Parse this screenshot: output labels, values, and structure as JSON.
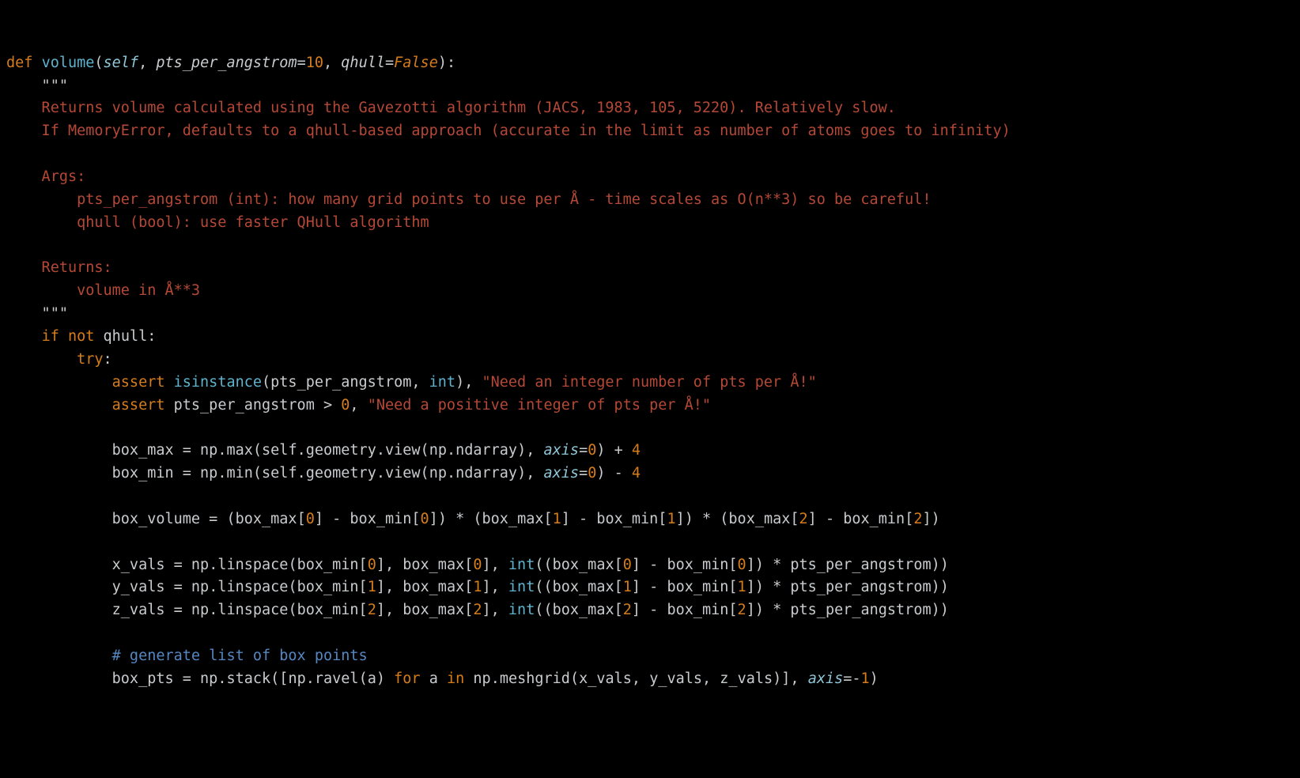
{
  "code": {
    "l01": {
      "def": "def",
      "sp": " ",
      "name": "volume",
      "lp": "(",
      "self": "self",
      "c1": ", ",
      "p1": "pts_per_angstrom",
      "eq1": "=",
      "v1": "10",
      "c2": ", ",
      "p2": "qhull",
      "eq2": "=",
      "v2": "False",
      "rp": "):"
    },
    "l02": "    \"\"\"",
    "l03": "    Returns volume calculated using the Gavezotti algorithm (JACS, 1983, 105, 5220). Relatively slow.",
    "l04": "    If MemoryError, defaults to a qhull-based approach (accurate in the limit as number of atoms goes to infinity)",
    "l05": "",
    "l06": "    Args:",
    "l07": "        pts_per_angstrom (int): how many grid points to use per Å - time scales as O(n**3) so be careful!",
    "l08": "        qhull (bool): use faster QHull algorithm",
    "l09": "",
    "l10": "    Returns:",
    "l11": "        volume in Å**3",
    "l12": "    \"\"\"",
    "l13": {
      "indent": "    ",
      "if": "if",
      "sp": " ",
      "not": "not",
      "sp2": " ",
      "q": "qhull",
      "col": ":"
    },
    "l14": {
      "indent": "        ",
      "try": "try",
      "col": ":"
    },
    "l15": {
      "indent": "            ",
      "assert": "assert",
      "sp": " ",
      "isinst": "isinstance",
      "lp": "(",
      "p": "pts_per_angstrom",
      "c": ", ",
      "int": "int",
      "rp": ")",
      "c2": ", ",
      "s": "\"Need an integer number of pts per Å!\""
    },
    "l16": {
      "indent": "            ",
      "assert": "assert",
      "sp": " ",
      "p": "pts_per_angstrom",
      "op": " > ",
      "z": "0",
      "c": ", ",
      "s": "\"Need a positive integer of pts per Å!\""
    },
    "l17": "",
    "l18": {
      "indent": "            ",
      "lhs": "box_max",
      "eq": " = ",
      "np": "np",
      "d1": ".",
      "max": "max",
      "lp": "(",
      "self": "self",
      "d2": ".",
      "geo": "geometry",
      "d3": ".",
      "view": "view",
      "lp2": "(",
      "np2": "np",
      "d4": ".",
      "nd": "ndarray",
      "rp2": ")",
      "c": ", ",
      "axis": "axis",
      "eq2": "=",
      "z": "0",
      "rp": ")",
      "plus": " + ",
      "four": "4"
    },
    "l19": {
      "indent": "            ",
      "lhs": "box_min",
      "eq": " = ",
      "np": "np",
      "d1": ".",
      "min": "min",
      "lp": "(",
      "self": "self",
      "d2": ".",
      "geo": "geometry",
      "d3": ".",
      "view": "view",
      "lp2": "(",
      "np2": "np",
      "d4": ".",
      "nd": "ndarray",
      "rp2": ")",
      "c": ", ",
      "axis": "axis",
      "eq2": "=",
      "z": "0",
      "rp": ")",
      "minus": " - ",
      "four": "4"
    },
    "l20": "",
    "l21": {
      "indent": "            ",
      "lhs": "box_volume",
      "eq": " = ",
      "lp1": "(",
      "bm": "box_max",
      "lb1": "[",
      "i0a": "0",
      "rb1": "]",
      "m1": " - ",
      "bn": "box_min",
      "lb2": "[",
      "i0b": "0",
      "rb2": "]",
      "rp1": ")",
      "t1": " * ",
      "lp2": "(",
      "bm2": "box_max",
      "lb3": "[",
      "i1a": "1",
      "rb3": "]",
      "m2": " - ",
      "bn2": "box_min",
      "lb4": "[",
      "i1b": "1",
      "rb4": "]",
      "rp2": ")",
      "t2": " * ",
      "lp3": "(",
      "bm3": "box_max",
      "lb5": "[",
      "i2a": "2",
      "rb5": "]",
      "m3": " - ",
      "bn3": "box_min",
      "lb6": "[",
      "i2b": "2",
      "rb6": "]",
      "rp3": ")"
    },
    "l22": "",
    "l23": {
      "indent": "            ",
      "lhs": "x_vals",
      "eq": " = ",
      "np": "np",
      "d": ".",
      "ls": "linspace",
      "lp": "(",
      "bn": "box_min",
      "lb1": "[",
      "i0a": "0",
      "rb1": "]",
      "c1": ", ",
      "bm": "box_max",
      "lb2": "[",
      "i0b": "0",
      "rb2": "]",
      "c2": ", ",
      "int": "int",
      "lp2": "((",
      "bm2": "box_max",
      "lb3": "[",
      "i0c": "0",
      "rb3": "]",
      "m": " - ",
      "bn2": "box_min",
      "lb4": "[",
      "i0d": "0",
      "rb4": "]",
      "rp2": ")",
      "t": " * ",
      "pp": "pts_per_angstrom",
      "rp": "))"
    },
    "l24": {
      "indent": "            ",
      "lhs": "y_vals",
      "eq": " = ",
      "np": "np",
      "d": ".",
      "ls": "linspace",
      "lp": "(",
      "bn": "box_min",
      "lb1": "[",
      "i0a": "1",
      "rb1": "]",
      "c1": ", ",
      "bm": "box_max",
      "lb2": "[",
      "i0b": "1",
      "rb2": "]",
      "c2": ", ",
      "int": "int",
      "lp2": "((",
      "bm2": "box_max",
      "lb3": "[",
      "i0c": "1",
      "rb3": "]",
      "m": " - ",
      "bn2": "box_min",
      "lb4": "[",
      "i0d": "1",
      "rb4": "]",
      "rp2": ")",
      "t": " * ",
      "pp": "pts_per_angstrom",
      "rp": "))"
    },
    "l25": {
      "indent": "            ",
      "lhs": "z_vals",
      "eq": " = ",
      "np": "np",
      "d": ".",
      "ls": "linspace",
      "lp": "(",
      "bn": "box_min",
      "lb1": "[",
      "i0a": "2",
      "rb1": "]",
      "c1": ", ",
      "bm": "box_max",
      "lb2": "[",
      "i0b": "2",
      "rb2": "]",
      "c2": ", ",
      "int": "int",
      "lp2": "((",
      "bm2": "box_max",
      "lb3": "[",
      "i0c": "2",
      "rb3": "]",
      "m": " - ",
      "bn2": "box_min",
      "lb4": "[",
      "i0d": "2",
      "rb4": "]",
      "rp2": ")",
      "t": " * ",
      "pp": "pts_per_angstrom",
      "rp": "))"
    },
    "l26": "",
    "l27": "            # generate list of box points",
    "l28": {
      "indent": "            ",
      "lhs": "box_pts",
      "eq": " = ",
      "np": "np",
      "d": ".",
      "st": "stack",
      "lp": "([",
      "np2": "np",
      "d2": ".",
      "rv": "ravel",
      "lp2": "(",
      "a": "a",
      "rp2": ")",
      "sp": " ",
      "for": "for",
      "sp2": " ",
      "a2": "a",
      "sp3": " ",
      "in": "in",
      "sp4": " ",
      "np3": "np",
      "d3": ".",
      "mg": "meshgrid",
      "lp3": "(",
      "xv": "x_vals",
      "c1": ", ",
      "yv": "y_vals",
      "c2": ", ",
      "zv": "z_vals",
      "rp3": ")]",
      "c3": ", ",
      "axis": "axis",
      "eq2": "=",
      "m1": "-",
      "one": "1",
      "rp": ")"
    }
  }
}
